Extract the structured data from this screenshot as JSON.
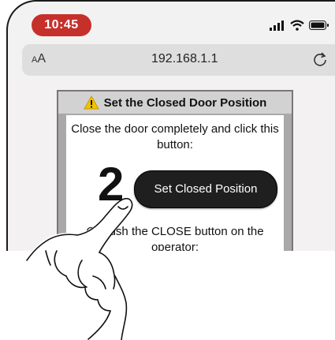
{
  "status_bar": {
    "time": "10:45",
    "icons": [
      "cellular-signal-icon",
      "wifi-icon",
      "battery-icon"
    ]
  },
  "address_bar": {
    "text_size_label_small": "A",
    "text_size_label_large": "A",
    "url": "192.168.1.1",
    "reload_icon": "reload-icon"
  },
  "panel": {
    "warning_icon": "warning-icon",
    "title": "Set the Closed Door Position",
    "instruction": "Close the door completely and click this button:",
    "step_number": "2",
    "button_label": "Set Closed Position",
    "instruction_2": "Or push the CLOSE button on the operator:"
  },
  "colors": {
    "time_pill": "#c6302b",
    "button": "#1f1f1f",
    "panel_border": "#a9a9a9"
  }
}
